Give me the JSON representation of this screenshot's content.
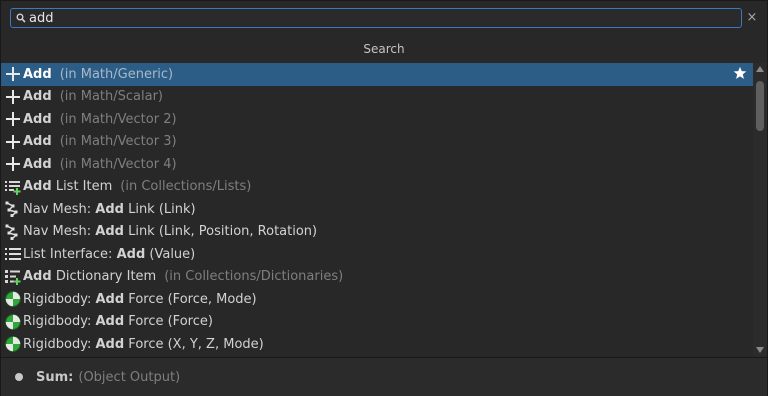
{
  "search": {
    "value": "add",
    "clear_label": "×"
  },
  "header": {
    "title": "Search"
  },
  "results": [
    {
      "icon": "plus-icon",
      "prefix": "",
      "bold": "Add",
      "suffix": "",
      "category": "(in Math/Generic)",
      "selected": true,
      "favorite": true
    },
    {
      "icon": "plus-icon",
      "prefix": "",
      "bold": "Add",
      "suffix": "",
      "category": "(in Math/Scalar)"
    },
    {
      "icon": "plus-icon",
      "prefix": "",
      "bold": "Add",
      "suffix": "",
      "category": "(in Math/Vector 2)"
    },
    {
      "icon": "plus-icon",
      "prefix": "",
      "bold": "Add",
      "suffix": "",
      "category": "(in Math/Vector 3)"
    },
    {
      "icon": "plus-icon",
      "prefix": "",
      "bold": "Add",
      "suffix": "",
      "category": "(in Math/Vector 4)"
    },
    {
      "icon": "list-add-icon",
      "prefix": "",
      "bold": "Add",
      "suffix": " List Item",
      "category": "(in Collections/Lists)"
    },
    {
      "icon": "nav-mesh-icon",
      "prefix": "Nav Mesh: ",
      "bold": "Add",
      "suffix": " Link (Link)",
      "category": ""
    },
    {
      "icon": "nav-mesh-icon",
      "prefix": "Nav Mesh: ",
      "bold": "Add",
      "suffix": " Link (Link, Position, Rotation)",
      "category": ""
    },
    {
      "icon": "list-icon",
      "prefix": "List Interface: ",
      "bold": "Add",
      "suffix": " (Value)",
      "category": ""
    },
    {
      "icon": "dictionary-add-icon",
      "prefix": "",
      "bold": "Add",
      "suffix": " Dictionary Item",
      "category": "(in Collections/Dictionaries)"
    },
    {
      "icon": "rigidbody-icon",
      "prefix": "Rigidbody: ",
      "bold": "Add",
      "suffix": " Force (Force, Mode)",
      "category": ""
    },
    {
      "icon": "rigidbody-icon",
      "prefix": "Rigidbody: ",
      "bold": "Add",
      "suffix": " Force (Force)",
      "category": ""
    },
    {
      "icon": "rigidbody-icon",
      "prefix": "Rigidbody: ",
      "bold": "Add",
      "suffix": " Force (X, Y, Z, Mode)",
      "category": ""
    }
  ],
  "footer": {
    "label": "Sum:",
    "detail": "(Object Output)"
  },
  "colors": {
    "selection": "#2c5d87",
    "focus_border": "#3a79bb",
    "rigidbody_green": "#2fa83a"
  }
}
